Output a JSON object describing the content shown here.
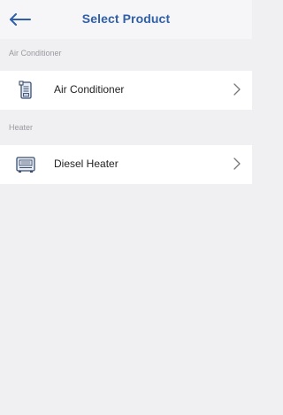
{
  "header": {
    "title": "Select Product",
    "back_icon": "arrow-left-icon",
    "accent_color": "#2f5fa8"
  },
  "sections": [
    {
      "label": "Air Conditioner",
      "items": [
        {
          "label": "Air Conditioner",
          "icon": "air-conditioner-icon",
          "chevron": "chevron-right-icon"
        }
      ]
    },
    {
      "label": "Heater",
      "items": [
        {
          "label": "Diesel Heater",
          "icon": "diesel-heater-icon",
          "chevron": "chevron-right-icon"
        }
      ]
    }
  ]
}
